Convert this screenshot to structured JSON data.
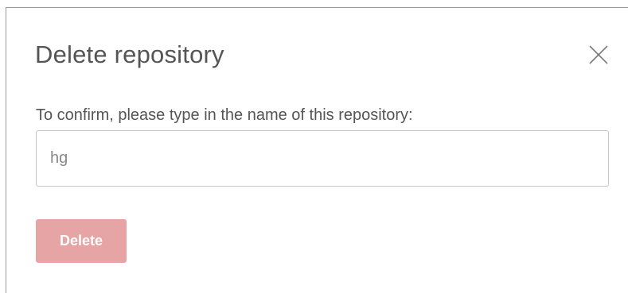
{
  "dialog": {
    "title": "Delete repository",
    "close_icon": "close-icon",
    "prompt": "To confirm, please type in the name of this repository:",
    "input": {
      "value": "hg",
      "placeholder": ""
    },
    "delete_button": {
      "label": "Delete",
      "state": "disabled"
    }
  },
  "colors": {
    "title_text": "#555555",
    "body_text": "#555555",
    "input_border": "#c7c7c7",
    "input_text": "#888888",
    "delete_button_bg": "#e6a4a4",
    "delete_button_text": "#ffffff"
  }
}
